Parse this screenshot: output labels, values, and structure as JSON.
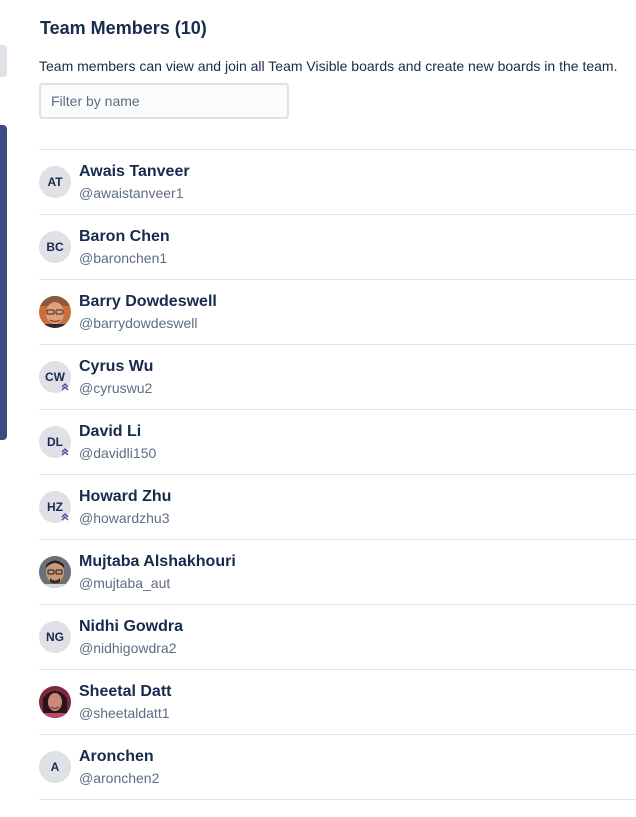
{
  "header": {
    "title": "Team Members (10)",
    "description": "Team members can view and join all Team Visible boards and create new boards in the team."
  },
  "filter": {
    "placeholder": "Filter by name",
    "value": ""
  },
  "members": [
    {
      "name": "Awais Tanveer",
      "username": "@awaistanveer1",
      "initials": "AT",
      "photo": false,
      "admin": false
    },
    {
      "name": "Baron Chen",
      "username": "@baronchen1",
      "initials": "BC",
      "photo": false,
      "admin": false
    },
    {
      "name": "Barry Dowdeswell",
      "username": "@barrydowdeswell",
      "initials": "",
      "photo": true,
      "admin": false
    },
    {
      "name": "Cyrus Wu",
      "username": "@cyruswu2",
      "initials": "CW",
      "photo": false,
      "admin": true
    },
    {
      "name": "David Li",
      "username": "@davidli150",
      "initials": "DL",
      "photo": false,
      "admin": true
    },
    {
      "name": "Howard Zhu",
      "username": "@howardzhu3",
      "initials": "HZ",
      "photo": false,
      "admin": true
    },
    {
      "name": "Mujtaba Alshakhouri",
      "username": "@mujtaba_aut",
      "initials": "",
      "photo": true,
      "admin": false
    },
    {
      "name": "Nidhi Gowdra",
      "username": "@nidhigowdra2",
      "initials": "NG",
      "photo": false,
      "admin": false
    },
    {
      "name": "Sheetal Datt",
      "username": "@sheetaldatt1",
      "initials": "",
      "photo": true,
      "admin": false
    },
    {
      "name": "Aronchen",
      "username": "@aronchen2",
      "initials": "A",
      "photo": false,
      "admin": false
    }
  ],
  "colors": {
    "text": "#172b4d",
    "subtle_text": "#5e6c84",
    "avatar_bg": "#dfe1e6",
    "admin_badge": "#3b4a9c",
    "side_panel": "#3b4a80"
  }
}
